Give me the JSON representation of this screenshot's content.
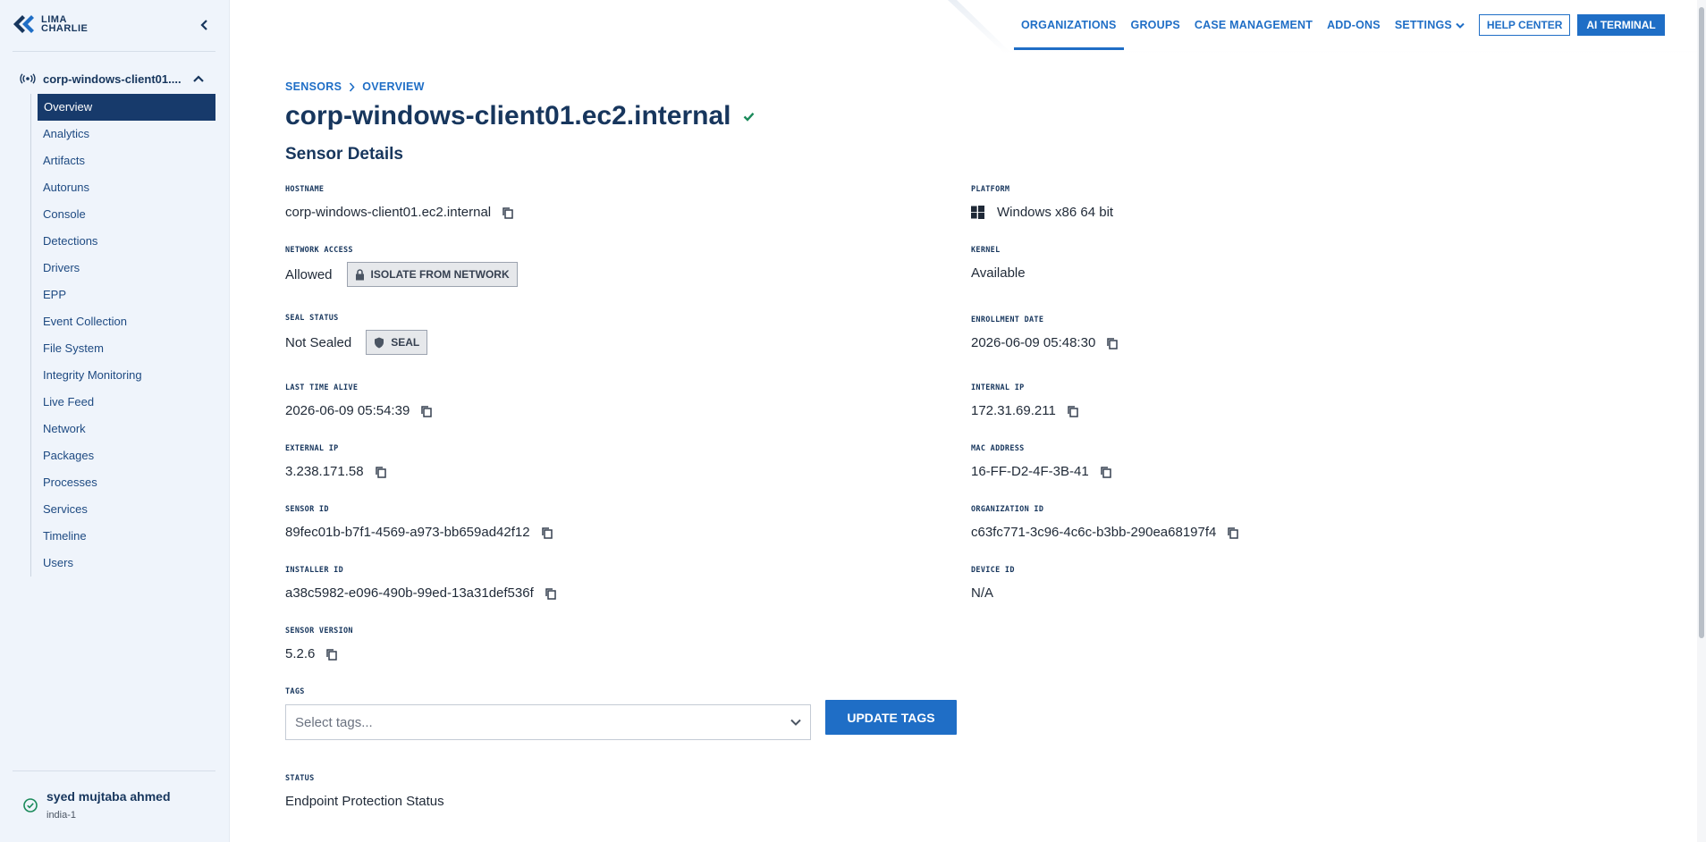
{
  "brand": {
    "line1": "LIMA",
    "line2": "CHARLIE"
  },
  "sidebar": {
    "sensor_name": "corp-windows-client01....",
    "items": [
      {
        "label": "Overview",
        "active": true
      },
      {
        "label": "Analytics"
      },
      {
        "label": "Artifacts"
      },
      {
        "label": "Autoruns"
      },
      {
        "label": "Console"
      },
      {
        "label": "Detections"
      },
      {
        "label": "Drivers"
      },
      {
        "label": "EPP"
      },
      {
        "label": "Event Collection"
      },
      {
        "label": "File System"
      },
      {
        "label": "Integrity Monitoring"
      },
      {
        "label": "Live Feed"
      },
      {
        "label": "Network"
      },
      {
        "label": "Packages"
      },
      {
        "label": "Processes"
      },
      {
        "label": "Services"
      },
      {
        "label": "Timeline"
      },
      {
        "label": "Users"
      }
    ],
    "user": {
      "name": "syed mujtaba ahmed",
      "region": "india-1"
    }
  },
  "topnav": {
    "organizations": "ORGANIZATIONS",
    "groups": "GROUPS",
    "case_management": "CASE MANAGEMENT",
    "addons": "ADD-ONS",
    "settings": "SETTINGS",
    "help_center": "HELP CENTER",
    "ai_terminal": "AI TERMINAL"
  },
  "breadcrumb": {
    "sensors": "SENSORS",
    "overview": "OVERVIEW"
  },
  "page": {
    "title": "corp-windows-client01.ec2.internal",
    "section": "Sensor Details"
  },
  "fields": {
    "hostname": {
      "label": "HOSTNAME",
      "value": "corp-windows-client01.ec2.internal"
    },
    "platform": {
      "label": "PLATFORM",
      "value": "Windows x86 64 bit"
    },
    "network_access": {
      "label": "NETWORK ACCESS",
      "value": "Allowed",
      "button": "ISOLATE FROM NETWORK"
    },
    "kernel": {
      "label": "KERNEL",
      "value": "Available"
    },
    "seal_status": {
      "label": "SEAL STATUS",
      "value": "Not Sealed",
      "button": "SEAL"
    },
    "enrollment_date": {
      "label": "ENROLLMENT DATE",
      "value": "2026-06-09 05:48:30"
    },
    "last_time_alive": {
      "label": "LAST TIME ALIVE",
      "value": "2026-06-09 05:54:39"
    },
    "internal_ip": {
      "label": "INTERNAL IP",
      "value": "172.31.69.211"
    },
    "external_ip": {
      "label": "EXTERNAL IP",
      "value": "3.238.171.58"
    },
    "mac_address": {
      "label": "MAC ADDRESS",
      "value": "16-FF-D2-4F-3B-41"
    },
    "sensor_id": {
      "label": "SENSOR ID",
      "value": "89fec01b-b7f1-4569-a973-bb659ad42f12"
    },
    "organization_id": {
      "label": "ORGANIZATION ID",
      "value": "c63fc771-3c96-4c6c-b3bb-290ea68197f4"
    },
    "installer_id": {
      "label": "INSTALLER ID",
      "value": "a38c5982-e096-490b-99ed-13a31def536f"
    },
    "device_id": {
      "label": "DEVICE ID",
      "value": "N/A"
    },
    "sensor_version": {
      "label": "SENSOR VERSION",
      "value": "5.2.6"
    },
    "tags": {
      "label": "TAGS",
      "placeholder": "Select tags...",
      "button": "UPDATE TAGS"
    },
    "status": {
      "label": "STATUS",
      "value": "Endpoint Protection Status"
    }
  },
  "colors": {
    "accent": "#1f6ec6",
    "navy": "#17365d",
    "sidebar_bg": "#eff4fb",
    "success": "#1a8a5a"
  }
}
